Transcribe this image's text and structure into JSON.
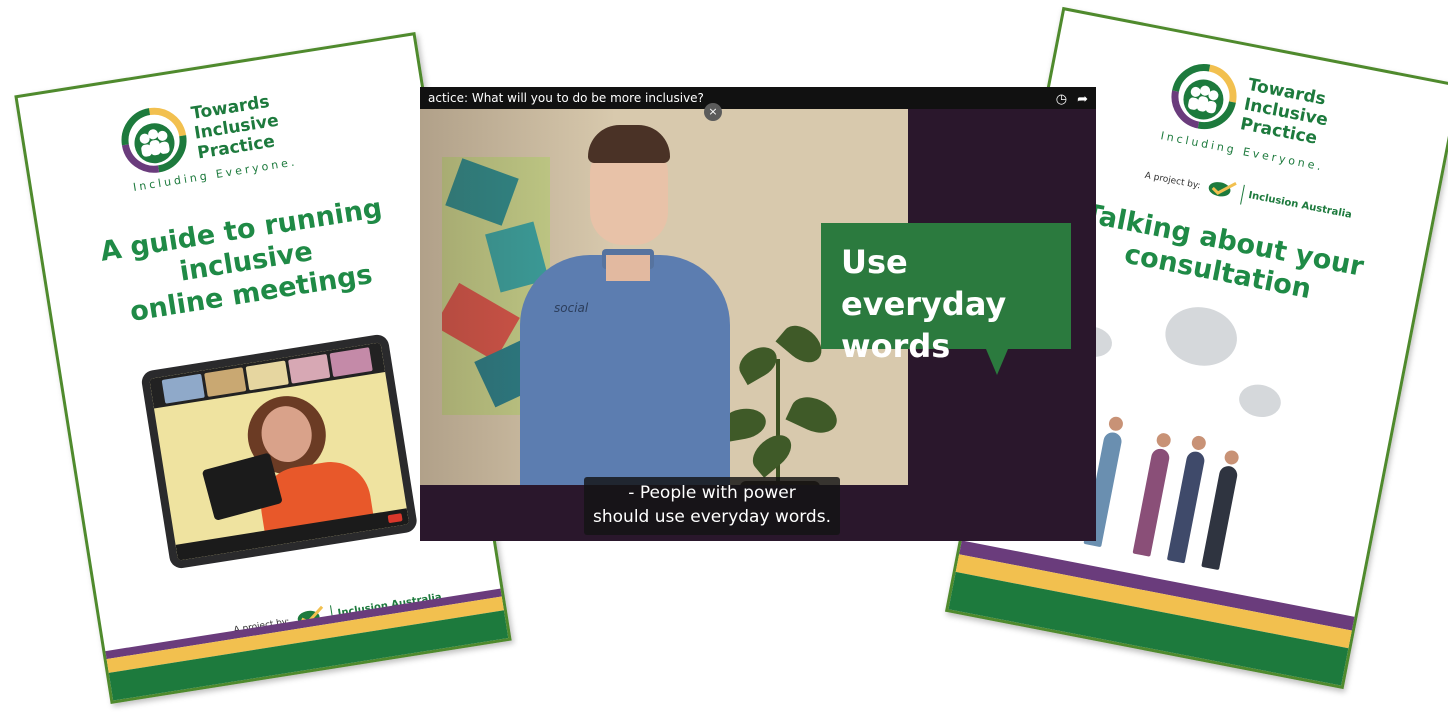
{
  "left_booklet": {
    "logo_lines": [
      "Towards",
      "Inclusive",
      "Practice"
    ],
    "tagline": "Including Everyone.",
    "title_line1": "A guide to running inclusive",
    "title_line2": "online meetings",
    "project_by": "A project by:",
    "org_name": "Inclusion Australia"
  },
  "video": {
    "title": "actice: What will you to do be more inclusive?",
    "close_symbol": "×",
    "clock_symbol": "◷",
    "share_symbol": "➦",
    "speech_line1": "Use everyday",
    "speech_line2": "words",
    "caption_line1": "- People with power",
    "caption_line2": "should use everyday words.",
    "shirt_logo": "social"
  },
  "right_booklet": {
    "logo_lines": [
      "Towards",
      "Inclusive",
      "Practice"
    ],
    "tagline": "Including Everyone.",
    "project_by": "A project by:",
    "org_name": "Inclusion Australia",
    "title_line1": "Talking about your",
    "title_line2": "consultation"
  },
  "colors": {
    "brand_green": "#1d7a3d",
    "purple": "#6a3c7c",
    "yellow": "#f2c04f",
    "speech_green": "#2b7a3e",
    "border_green": "#4f8a2d"
  }
}
